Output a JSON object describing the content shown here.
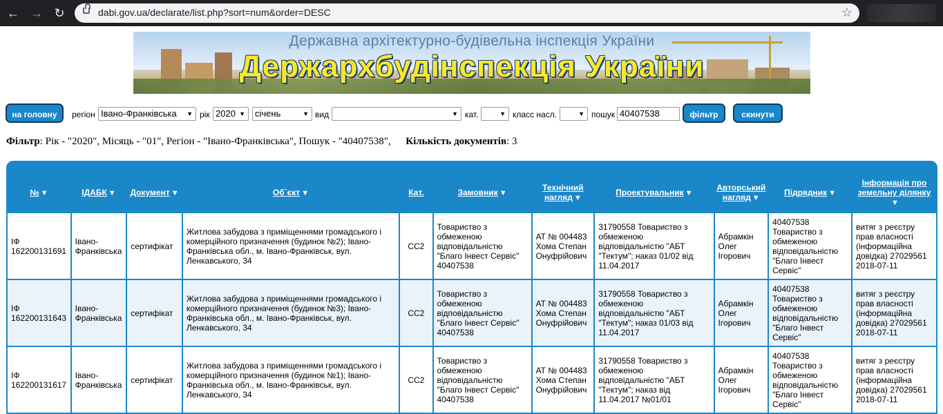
{
  "browser": {
    "url": "dabi.gov.ua/declarate/list.php?sort=num&order=DESC",
    "back_icon": "←",
    "forward_icon": "→",
    "reload_icon": "↻",
    "star_icon": "☆"
  },
  "banner": {
    "subtitle": "Державна архітектурно-будівельна інспекція України",
    "title": "Держархбудінспекція України"
  },
  "filter": {
    "home_button": "на головну",
    "region_label": "регіон",
    "region_value": "Івано-Франківська",
    "year_label": "рік",
    "year_value": "2020",
    "month_value": "січень",
    "type_label": "вид",
    "type_value": "",
    "cat_label": "кат.",
    "cat_value": "",
    "class_label": "класс насл.",
    "class_value": "",
    "search_label": "пошук",
    "search_value": "40407538",
    "filter_button": "фільтр",
    "reset_button": "скинути"
  },
  "summary": {
    "filter_label": "Фільтр",
    "filter_text": ": Рік - \"2020\", Місяць - \"01\", Регіон - \"Івано-Франківська\", Пошук - \"40407538\",",
    "count_label": "Кількість документів",
    "count_value": ": 3"
  },
  "table": {
    "headers": [
      "№",
      "ІДАБК",
      "Документ",
      "Об`єкт",
      "Кат.",
      "Замовник",
      "Технічний нагляд",
      "Проектувальник",
      "Авторський нагляд",
      "Підрядник",
      "Інформація про земельну ділянку"
    ],
    "sort_icon": "▼",
    "rows": [
      {
        "num": "ІФ 162200131691",
        "idabk": "Івано-Франківська",
        "doc": "сертифікат",
        "object": "Житлова забудова з приміщеннями громадського і комерційного призначення (будинок №2); Івано-Франківська обл., м. Івано-Франківськ, вул. Ленкавського, 34",
        "cat": "СС2",
        "customer": "Товариство з обмеженою відповідальністю \"Благо Інвест Сервіс\" 40407538",
        "tech": "АТ № 004483 Хома Степан Онуфрійович",
        "designer": "31790558 Товариство з обмеженою відповідальністю \"АБТ \"Тектум\"; наказ 01/02 від 11.04.2017",
        "author": "Абрамкін Олег Ігорович",
        "contractor": "40407538 Товариство з обмеженою відповідальністю \"Благо Інвест Сервіс\"",
        "land": "витяг з реєстру прав власності (інформаційна довідка) 27029561 2018-07-11"
      },
      {
        "num": "ІФ 162200131643",
        "idabk": "Івано-Франківська",
        "doc": "сертифікат",
        "object": "Житлова забудова з приміщеннями громадського і комерційного призначення (будинок №3); Івано-Франківська обл., м. Івано-Франківськ, вул. Ленкавського, 34",
        "cat": "СС2",
        "customer": "Товариство з обмеженою відповідальністю \"Благо Інвест Сервіс\" 40407538",
        "tech": "АТ № 004483 Хома Степан Онуфрійович",
        "designer": "31790558 Товариство з обмеженою відповідальністю \"АБТ \"Тектум\"; наказ 01/03 від 11.04.2017",
        "author": "Абрамкін Олег Ігорович",
        "contractor": "40407538 Товариство з обмеженою відповідальністю \"Благо Інвест Сервіс\"",
        "land": "витяг з реєстру прав власності (інформаційна довідка) 27029561 2018-07-11"
      },
      {
        "num": "ІФ 162200131617",
        "idabk": "Івано-Франківська",
        "doc": "сертифікат",
        "object": "Житлова забудова з приміщеннями громадського і комерційного призначення (будинок №1); Івано-Франківська обл., м. Івано-Франківськ, вул. Ленкавського, 34",
        "cat": "СС2",
        "customer": "Товариство з обмеженою відповідальністю \"Благо Інвест Сервіс\" 40407538",
        "tech": "АТ № 004483 Хома Степан Онуфрійович",
        "designer": "31790558 Товариство з обмеженою відповідальністю \"АБТ \"Тектум\"; наказ від 11.04.2017 №01/01",
        "author": "Абрамкін Олег Ігорович",
        "contractor": "40407538 Товариство з обмеженою відповідальністю \"Благо Інвест Сервіс\"",
        "land": "витяг з реєстру прав власності (інформаційна довідка) 27029561 2018-07-11"
      }
    ]
  }
}
